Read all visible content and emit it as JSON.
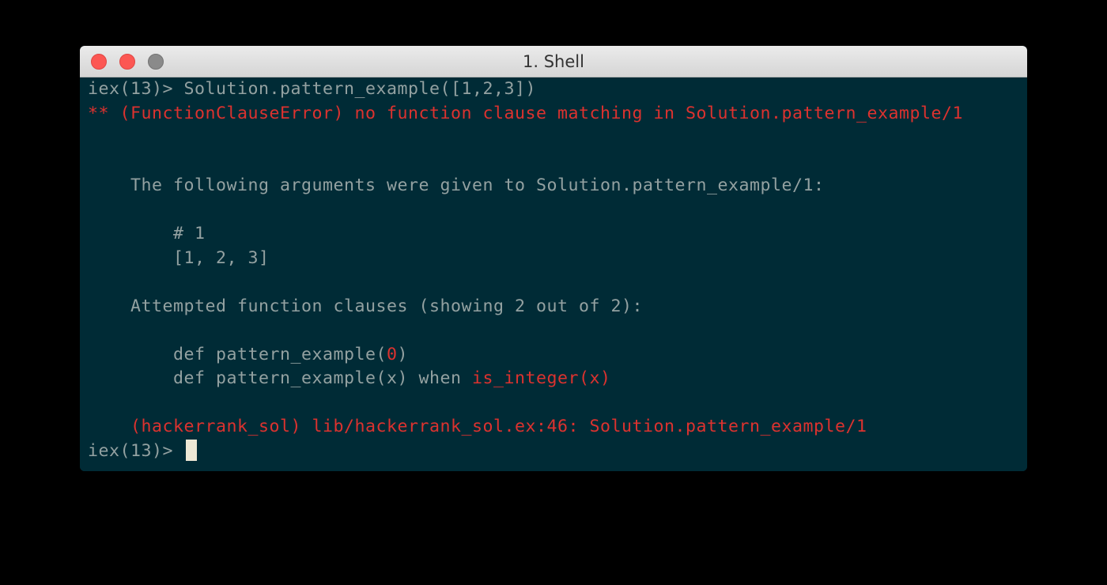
{
  "window": {
    "title": "1. Shell"
  },
  "terminal": {
    "prompt": "iex(13)> ",
    "command": "Solution.pattern_example([1,2,3])",
    "error_header": "** (FunctionClauseError) no function clause matching in Solution.pattern_example/1",
    "args_intro": "    The following arguments were given to Solution.pattern_example/1:",
    "arg_comment": "        # 1",
    "arg_value": "        [1, 2, 3]",
    "clauses_intro": "    Attempted function clauses (showing 2 out of 2):",
    "clause1_prefix": "        def pattern_example(",
    "clause1_highlight": "0",
    "clause1_suffix": ")",
    "clause2_prefix": "        def pattern_example(x) when ",
    "clause2_highlight": "is_integer(x)",
    "stacktrace": "    (hackerrank_sol) lib/hackerrank_sol.ex:46: Solution.pattern_example/1",
    "next_prompt": "iex(13)> "
  },
  "colors": {
    "background": "#002b36",
    "text": "#93a1a1",
    "error": "#dc322f"
  }
}
